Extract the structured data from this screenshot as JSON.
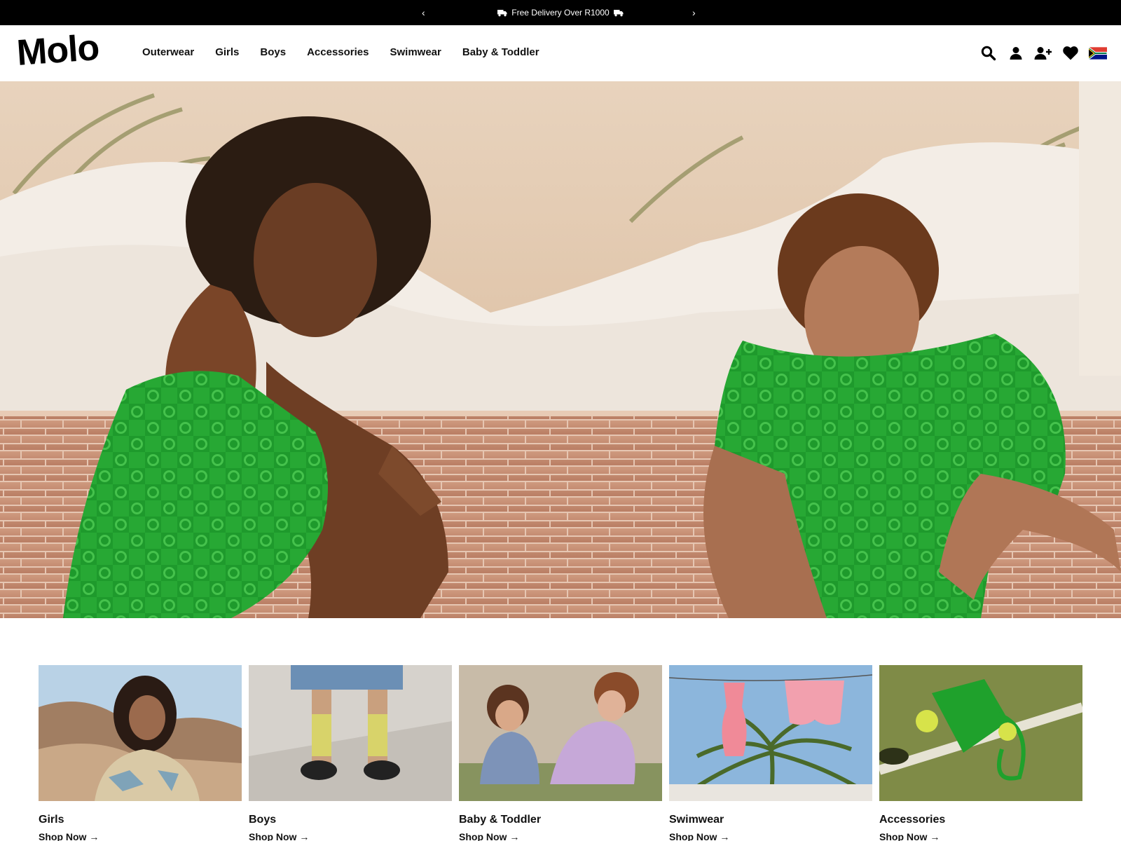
{
  "announcement": {
    "prev_arrow": "‹",
    "next_arrow": "›",
    "text": "Free Delivery Over R1000"
  },
  "header": {
    "logo": "Molo",
    "nav": [
      "Outerwear",
      "Girls",
      "Boys",
      "Accessories",
      "Swimwear",
      "Baby & Toddler"
    ],
    "icons": [
      "search-icon",
      "account-icon",
      "register-icon",
      "wishlist-heart-icon",
      "south-africa-flag-icon"
    ]
  },
  "hero": {
    "image": "two children in green terry outfits sitting on brick steps"
  },
  "categories": [
    {
      "name": "Girls",
      "cta": "Shop Now →"
    },
    {
      "name": "Boys",
      "cta": "Shop Now →"
    },
    {
      "name": "Baby & Toddler",
      "cta": "Shop Now →"
    },
    {
      "name": "Swimwear",
      "cta": "Shop Now →"
    },
    {
      "name": "Accessories",
      "cta": "Shop Now →"
    }
  ],
  "colors": {
    "topbar_bg": "#000000",
    "text": "#111111",
    "accent_green": "#1fa12c"
  }
}
